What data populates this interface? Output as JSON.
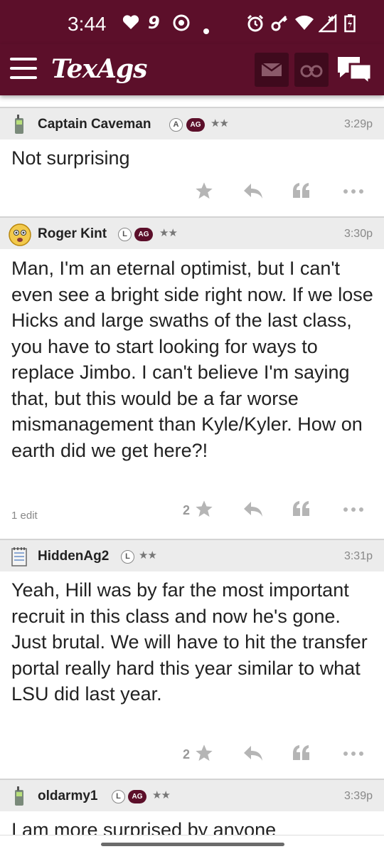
{
  "status_bar": {
    "time": "3:44",
    "notification_number": "9"
  },
  "app_bar": {
    "logo": "TexAgs"
  },
  "posts": [
    {
      "username": "Captain Caveman",
      "badge_letter": "A",
      "ag_badge": "AG",
      "stars": "★★",
      "time": "3:29p",
      "avatar_icon": "walkie-talkie-icon",
      "body": "Not surprising",
      "star_count": "",
      "edit_note": ""
    },
    {
      "username": "Roger Kint",
      "badge_letter": "L",
      "ag_badge": "AG",
      "stars": "★★",
      "time": "3:30p",
      "avatar_icon": "worried-face-icon",
      "body": "Man, I'm an eternal optimist, but I can't even see a bright side right now. If we lose Hicks and large swaths of the last class, you have to start looking for ways to replace Jimbo. I can't believe I'm saying that, but this would be a far worse mismanagement than Kyle/Kyler. How on earth did we get here?!",
      "star_count": "2",
      "edit_note": "1 edit"
    },
    {
      "username": "HiddenAg2",
      "badge_letter": "L",
      "ag_badge": "",
      "stars": "★★",
      "time": "3:31p",
      "avatar_icon": "notepad-icon",
      "body": "Yeah, Hill was by far the most important recruit in this class and now he's gone. Just brutal. We will have to hit the transfer portal really hard this year similar to what LSU did last year.",
      "star_count": "2",
      "edit_note": ""
    },
    {
      "username": "oldarmy1",
      "badge_letter": "L",
      "ag_badge": "AG",
      "stars": "★★",
      "time": "3:39p",
      "avatar_icon": "walkie-talkie-icon",
      "body": "I am more surprised by anyone",
      "star_count": "",
      "edit_note": ""
    }
  ],
  "colors": {
    "maroon": "#5c0f2a",
    "header_gray": "#ececec"
  }
}
